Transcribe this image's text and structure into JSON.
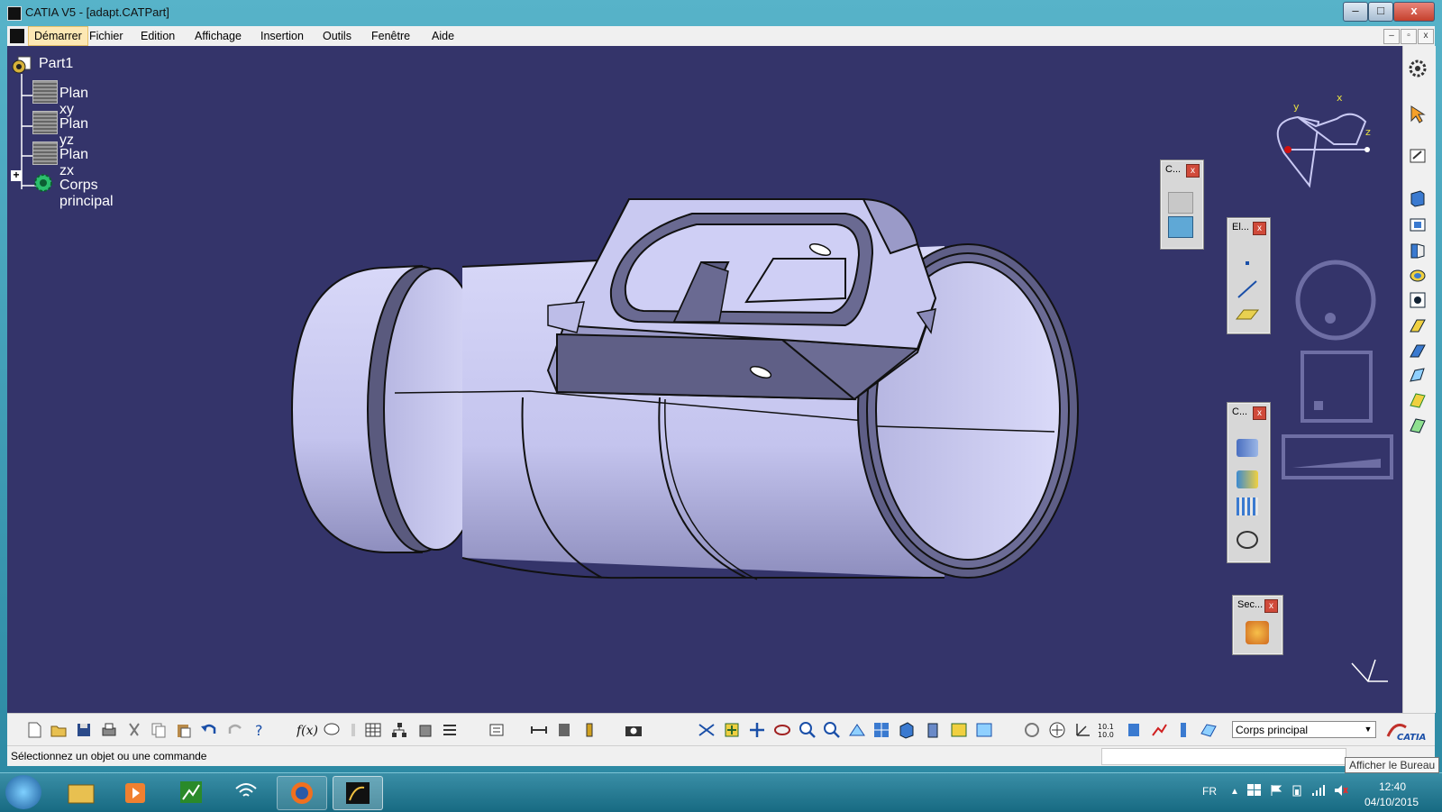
{
  "window": {
    "title": "CATIA V5 - [adapt.CATPart]",
    "min": "–",
    "max": "□",
    "close": "x"
  },
  "menu": {
    "items": [
      "Démarrer",
      "Fichier",
      "Edition",
      "Affichage",
      "Insertion",
      "Outils",
      "Fenêtre",
      "Aide"
    ],
    "mdi": [
      "–",
      "▫",
      "x"
    ]
  },
  "tree": {
    "root": "Part1",
    "children": [
      "Plan xy",
      "Plan yz",
      "Plan zx",
      "Corps principal"
    ],
    "expander": "+"
  },
  "compass": {
    "x": "x",
    "y": "y",
    "z": "z"
  },
  "palettes": [
    {
      "title": "C...",
      "close": "x"
    },
    {
      "title": "El...",
      "close": "x"
    },
    {
      "title": "C...",
      "close": "x"
    },
    {
      "title": "Sec...",
      "close": "x"
    }
  ],
  "toolbar": {
    "combo_value": "Corps principal",
    "brand": "CATIA"
  },
  "status": {
    "text": "Sélectionnez un objet ou une commande"
  },
  "taskbar": {
    "language": "FR",
    "time": "12:40",
    "date": "04/10/2015",
    "tooltip": "Afficher le Bureau"
  },
  "colors": {
    "viewport": "#34346a",
    "part": "#cfcff5",
    "accent": "#fde8b4"
  }
}
